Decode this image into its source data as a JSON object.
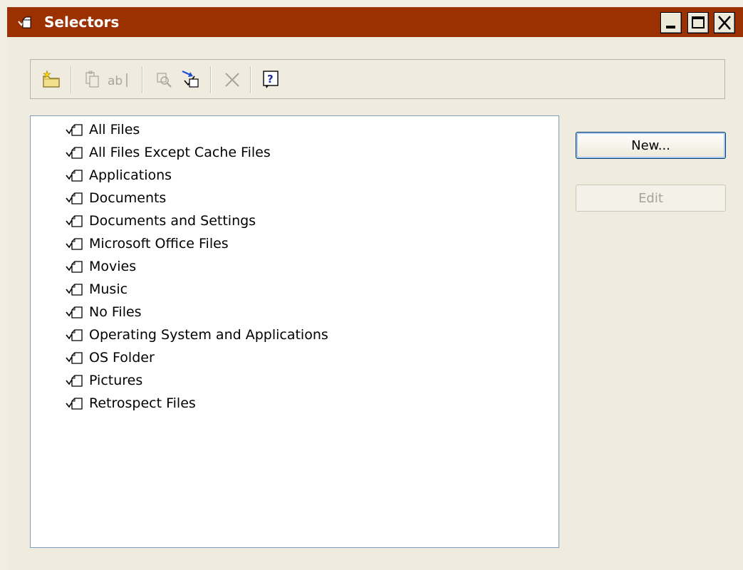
{
  "window": {
    "title": "Selectors",
    "controls": [
      "minimize",
      "maximize",
      "close"
    ]
  },
  "toolbar": {
    "buttons": [
      {
        "name": "new-folder",
        "icon": "new-folder-icon",
        "enabled": true
      },
      {
        "name": "copy",
        "icon": "copy-icon",
        "enabled": false
      },
      {
        "name": "rename",
        "icon": "rename-icon",
        "enabled": false
      },
      {
        "name": "find",
        "icon": "find-icon",
        "enabled": false
      },
      {
        "name": "import",
        "icon": "import-icon",
        "enabled": true
      },
      {
        "name": "delete",
        "icon": "delete-icon",
        "enabled": false
      },
      {
        "name": "help",
        "icon": "help-icon",
        "enabled": true
      }
    ]
  },
  "selectors": {
    "items": [
      "All Files",
      "All Files Except Cache Files",
      "Applications",
      "Documents",
      "Documents and Settings",
      "Microsoft Office Files",
      "Movies",
      "Music",
      "No Files",
      "Operating System and Applications",
      "OS Folder",
      "Pictures",
      "Retrospect Files"
    ]
  },
  "buttons": {
    "new_label": "New...",
    "edit_label": "Edit"
  },
  "colors": {
    "titlebar": "#9b3000",
    "window_bg": "#efebde"
  }
}
